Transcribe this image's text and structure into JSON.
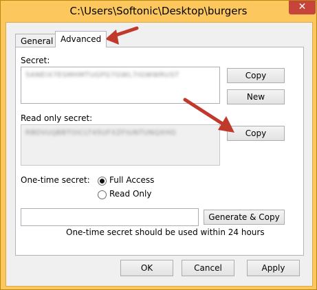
{
  "window": {
    "title": "C:\\Users\\Softonic\\Desktop\\burgers",
    "close_glyph": "✕"
  },
  "tabs": [
    {
      "label": "General"
    },
    {
      "label": "Advanced"
    }
  ],
  "secret": {
    "label": "Secret:",
    "value": "5ANEIX7ESMHMTUGPG7GWL7IGWWRUST",
    "copy_label": "Copy",
    "new_label": "New"
  },
  "read_only": {
    "label": "Read only secret:",
    "value": "RBDVUIJBBTOICLT45UFXZFIUNTUNQXHG",
    "copy_label": "Copy"
  },
  "one_time": {
    "label": "One-time secret:",
    "options": [
      {
        "label": "Full Access",
        "checked": true
      },
      {
        "label": "Read Only",
        "checked": false
      }
    ],
    "field_value": "",
    "generate_label": "Generate & Copy",
    "note": "One-time secret should be used within 24 hours"
  },
  "footer": {
    "ok_label": "OK",
    "cancel_label": "Cancel",
    "apply_label": "Apply"
  },
  "colors": {
    "frame": "#fcc75d",
    "close": "#c7443a",
    "arrow": "#c0392b"
  }
}
